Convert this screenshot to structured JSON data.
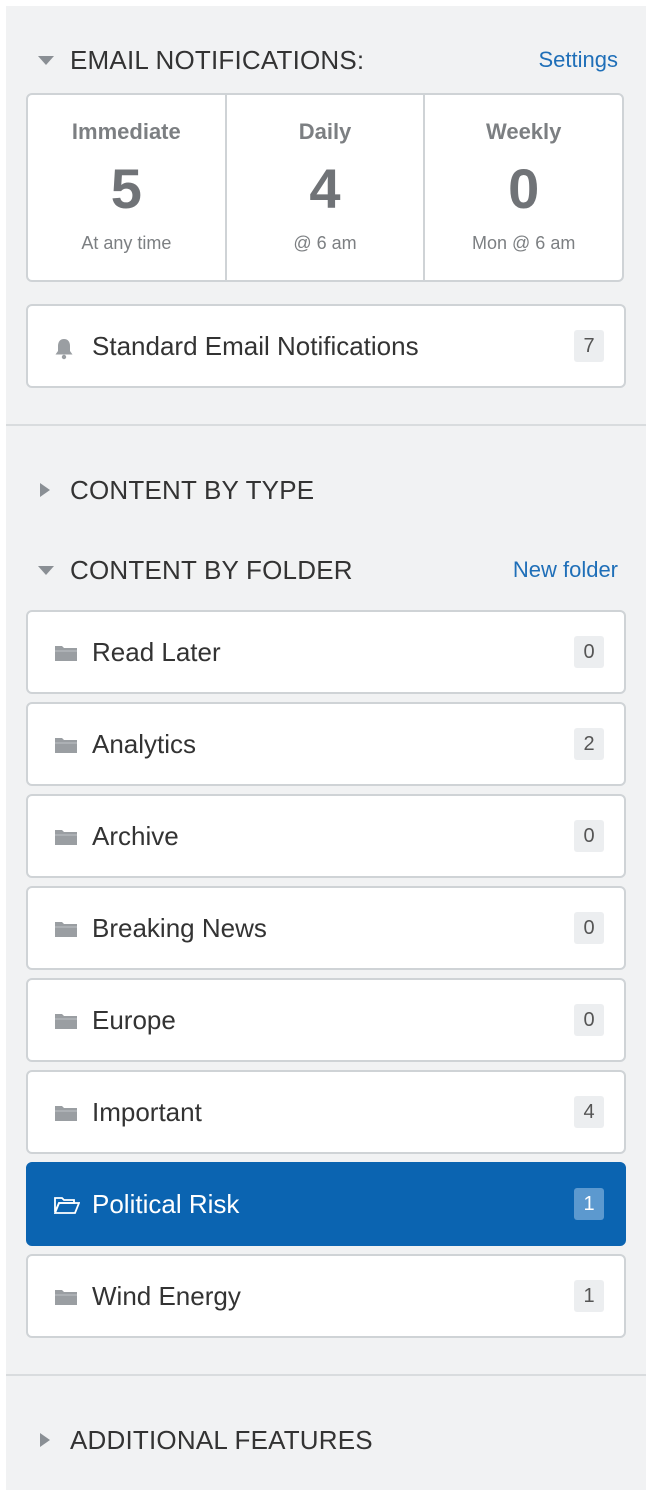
{
  "email_notifications": {
    "title": "EMAIL NOTIFICATIONS:",
    "settings_label": "Settings",
    "columns": [
      {
        "label": "Immediate",
        "count": "5",
        "sub": "At any time"
      },
      {
        "label": "Daily",
        "count": "4",
        "sub": "@ 6 am"
      },
      {
        "label": "Weekly",
        "count": "0",
        "sub": "Mon @ 6 am"
      }
    ],
    "standard": {
      "label": "Standard Email Notifications",
      "count": "7",
      "icon": "bell-icon"
    }
  },
  "content_by_type": {
    "title": "CONTENT BY TYPE"
  },
  "content_by_folder": {
    "title": "CONTENT BY FOLDER",
    "new_folder_label": "New folder",
    "folders": [
      {
        "label": "Read Later",
        "count": "0",
        "icon": "folder-icon"
      },
      {
        "label": "Analytics",
        "count": "2",
        "icon": "folder-icon"
      },
      {
        "label": "Archive",
        "count": "0",
        "icon": "folder-icon"
      },
      {
        "label": "Breaking News",
        "count": "0",
        "icon": "folder-icon"
      },
      {
        "label": "Europe",
        "count": "0",
        "icon": "folder-icon"
      },
      {
        "label": "Important",
        "count": "4",
        "icon": "folder-icon"
      },
      {
        "label": "Political Risk",
        "count": "1",
        "icon": "folder-open-icon",
        "selected": true
      },
      {
        "label": "Wind Energy",
        "count": "1",
        "icon": "folder-icon"
      }
    ]
  },
  "additional_features": {
    "title": "ADDITIONAL FEATURES"
  },
  "colors": {
    "accent": "#0b64b1",
    "link": "#1f6fb8",
    "panel_bg": "#f1f2f3",
    "border": "#cfd3d6"
  }
}
